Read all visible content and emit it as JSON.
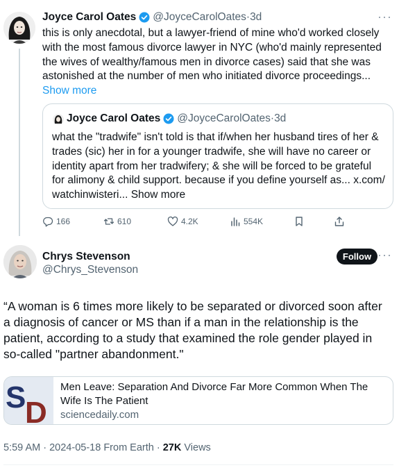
{
  "parent_tweet": {
    "author_name": "Joyce Carol Oates",
    "author_handle": "@JoyceCarolOates",
    "separator": "·",
    "time": "3d",
    "text": "this is only anecdotal, but a lawyer-friend of mine who'd worked closely with the most famous divorce lawyer in NYC  (who'd mainly represented the wives of  wealthy/famous men in divorce cases) said that she was astonished at the number of men who initiated divorce proceedings...",
    "show_more": "Show more",
    "more_icon": "more-horizontal-icon",
    "quoted": {
      "author_name": "Joyce Carol Oates",
      "author_handle": "@JoyceCarolOates",
      "separator": "·",
      "time": "3d",
      "text": "what the \"tradwife\" isn't told is that if/when her husband tires of her & trades (sic) her in for a younger tradwife, she will have no career or identity apart from her tradwifery; & she will be forced to be grateful for alimony & child support. because if you define yourself as... x.com/ watchinwisteri...",
      "show_more": "Show more"
    },
    "actions": {
      "replies": "166",
      "reposts": "610",
      "likes": "4.2K",
      "views": "554K"
    }
  },
  "main_tweet": {
    "author_name": "Chrys Stevenson",
    "author_handle": "@Chrys_Stevenson",
    "follow_label": "Follow",
    "text": "“A woman is 6 times more likely to be separated or divorced soon after a diagnosis of cancer or MS than if a man in the relationship is the patient, according to a study that examined the role gender played in so-called \"partner abandonment.\"",
    "card": {
      "logo_text": "SD",
      "title": "Men Leave: Separation And Divorce Far More Common When The Wife Is The Patient",
      "domain": "sciencedaily.com"
    },
    "meta": {
      "time": "5:59 AM",
      "date": "2024-05-18",
      "source": "From Earth",
      "views_count": "27K",
      "views_label": "Views",
      "separator": "·"
    }
  },
  "colors": {
    "verified_blue": "#1d9bf0",
    "secondary_text": "#536471",
    "border": "#cfd9de",
    "sd_blue": "#24356b",
    "sd_red": "#8a2b25"
  }
}
